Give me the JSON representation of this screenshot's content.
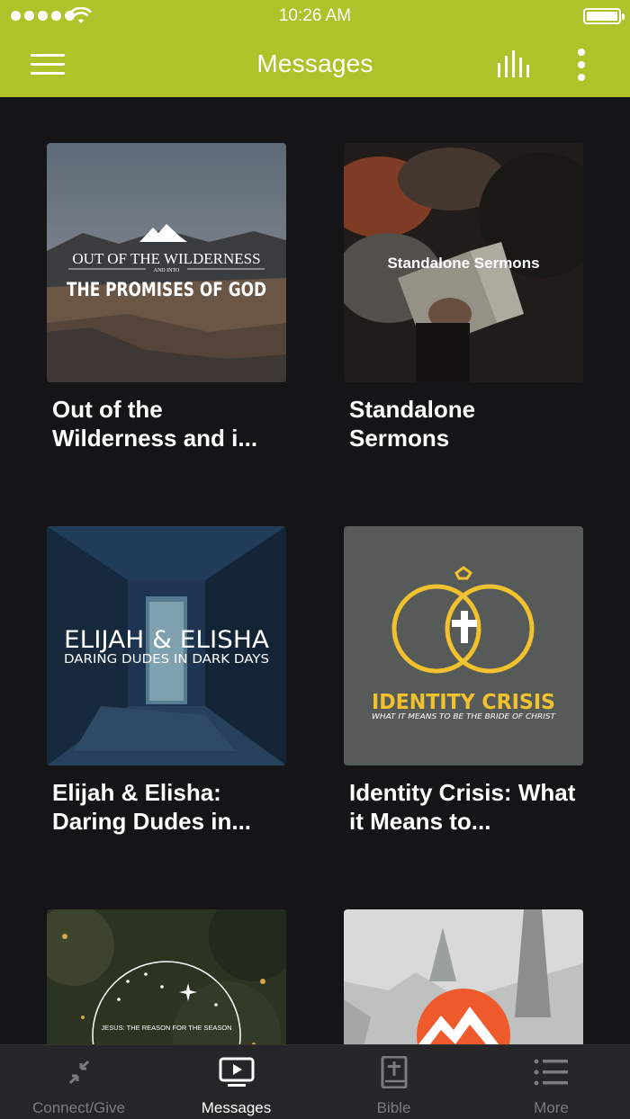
{
  "status_bar": {
    "time": "10:26 AM"
  },
  "header": {
    "title": "Messages"
  },
  "series": [
    {
      "title": "Out of the Wilderness and i...",
      "art_top": "OUT OF THE WILDERNESS",
      "art_small": "AND INTO",
      "art_main": "THE PROMISES OF GOD"
    },
    {
      "title": "Standalone Sermons",
      "art_text": "Standalone Sermons"
    },
    {
      "title": "Elijah & Elisha: Daring Dudes in...",
      "art_main": "ELIJAH & ELISHA",
      "art_sub": "DARING DUDES IN DARK DAYS"
    },
    {
      "title": "Identity Crisis: What it Means to...",
      "art_main": "IDENTITY CRISIS",
      "art_sub": "WHAT IT MEANS TO BE THE BRIDE OF CHRIST"
    },
    {
      "title": "",
      "art_text": "JESUS: THE REASON FOR THE SEASON"
    },
    {
      "title": ""
    }
  ],
  "tabs": [
    {
      "label": "Connect/Give",
      "icon": "compress-arrows-icon",
      "active": false
    },
    {
      "label": "Messages",
      "icon": "tv-play-icon",
      "active": true
    },
    {
      "label": "Bible",
      "icon": "bible-icon",
      "active": false
    },
    {
      "label": "More",
      "icon": "list-icon",
      "active": false
    }
  ],
  "colors": {
    "accent": "#aec22a",
    "background": "#151517",
    "tabbar": "#262628",
    "identity_yellow": "#f2c12e"
  }
}
